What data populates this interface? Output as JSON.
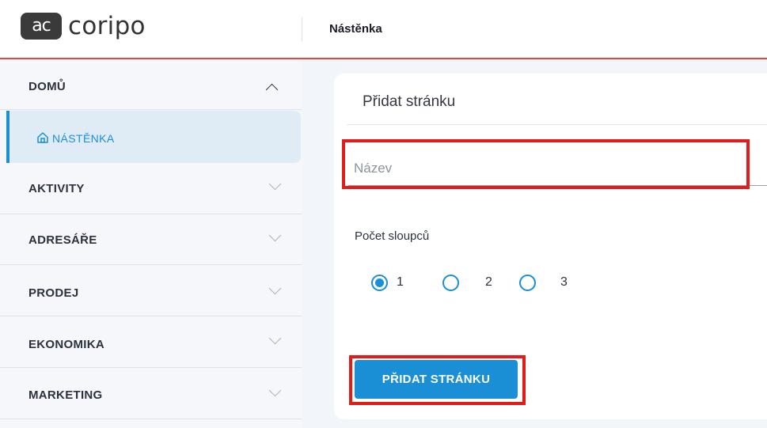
{
  "app": {
    "logo_mark": "ac",
    "logo_text": "coripo"
  },
  "header": {
    "page_title": "Nástěnka"
  },
  "colors": {
    "accent": "#1a8fd6",
    "header_line": "#e8453c",
    "highlight": "#e21b1b"
  },
  "sidebar": {
    "sections": [
      {
        "label": "DOMŮ",
        "expanded": true,
        "icon": "chevron-up-icon"
      },
      {
        "label": "AKTIVITY",
        "expanded": false,
        "icon": "chevron-down-icon"
      },
      {
        "label": "ADRESÁŘE",
        "expanded": false,
        "icon": "chevron-down-icon"
      },
      {
        "label": "PRODEJ",
        "expanded": false,
        "icon": "chevron-down-icon"
      },
      {
        "label": "EKONOMIKA",
        "expanded": false,
        "icon": "chevron-down-icon"
      },
      {
        "label": "MARKETING",
        "expanded": false,
        "icon": "chevron-down-icon"
      }
    ],
    "active_item": {
      "label": "NÁSTĚNKA",
      "icon": "home-icon"
    }
  },
  "form": {
    "title": "Přidat stránku",
    "name_field": {
      "placeholder": "Název",
      "value": ""
    },
    "columns_label": "Počet sloupců",
    "column_options": [
      "1",
      "2",
      "3"
    ],
    "selected_column": "1",
    "submit_label": "PŘIDAT STRÁNKU"
  }
}
